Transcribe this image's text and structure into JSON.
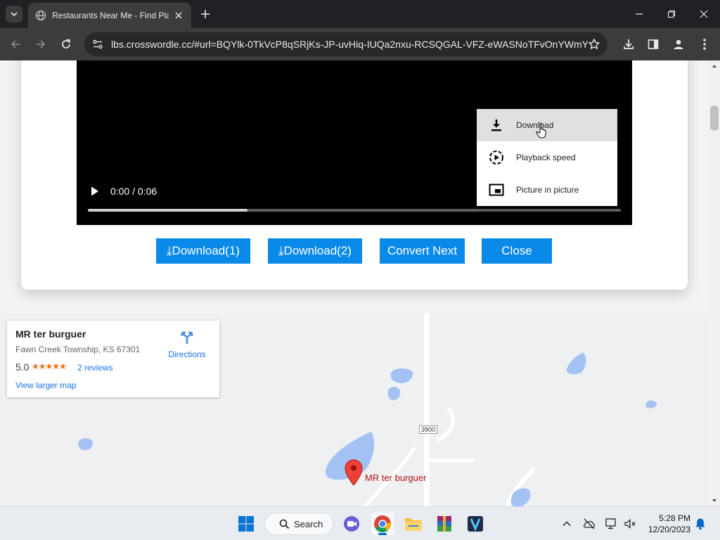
{
  "browser": {
    "tab_title": "Restaurants Near Me - Find Pla",
    "url": "lbs.crosswordle.cc/#url=BQYlk-0TkVcP8qSRjKs-JP-uvHiq-IUQa2nxu-RCSQGAL-VFZ-eWASNoTFvOnYWmY3..."
  },
  "video": {
    "time": "0:00 / 0:06",
    "progress_fraction": 0.3,
    "menu": [
      {
        "label": "Download",
        "icon": "download-icon"
      },
      {
        "label": "Playback speed",
        "icon": "playback-speed-icon"
      },
      {
        "label": "Picture in picture",
        "icon": "picture-in-picture-icon"
      }
    ]
  },
  "buttons": {
    "download1": "⤓Download(1)",
    "download2": "⤓Download(2)",
    "convert_next": "Convert Next",
    "close": "Close"
  },
  "place": {
    "name": "MR ter burguer",
    "address": "Fawn Creek Township, KS 67301",
    "rating": "5.0",
    "stars": "★★★★★",
    "reviews": "2 reviews",
    "larger_map": "View larger map",
    "directions": "Directions"
  },
  "map": {
    "road_label": "3900",
    "pin_label": "MR ter burguer"
  },
  "taskbar": {
    "search_label": "Search",
    "time": "5:28 PM",
    "date": "12/20/2023"
  },
  "colors": {
    "button_blue": "#0a8ae8",
    "water": "#a4c1f4",
    "pin_red": "#ea4335"
  }
}
